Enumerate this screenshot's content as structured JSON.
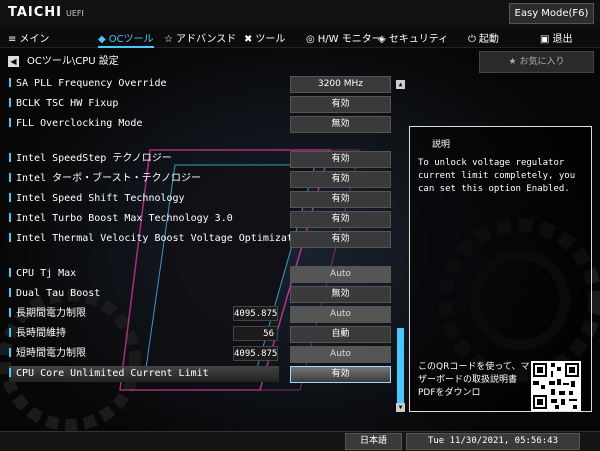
{
  "header": {
    "brand": "TAICHI",
    "brand_sub": "UEFI",
    "easy_mode": "Easy Mode(F6)"
  },
  "menu": {
    "items": [
      {
        "icon": "≡",
        "label": "メイン"
      },
      {
        "icon": "◆",
        "label": "OCツール"
      },
      {
        "icon": "☆",
        "label": "アドバンスド"
      },
      {
        "icon": "✖",
        "label": "ツール"
      },
      {
        "icon": "◎",
        "label": "H/W モニター"
      },
      {
        "icon": "◈",
        "label": "セキュリティ"
      },
      {
        "icon": "⏻",
        "label": "起動"
      },
      {
        "icon": "▣",
        "label": "退出"
      }
    ]
  },
  "breadcrumb": "OCツール\\CPU 設定",
  "favorites": "お気に入り",
  "settings": [
    {
      "label": "SA PLL Frequency Override",
      "value": "3200 MHz",
      "num": ""
    },
    {
      "label": "BCLK TSC HW Fixup",
      "value": "有効",
      "num": ""
    },
    {
      "label": "FLL Overclocking Mode",
      "value": "無効",
      "num": ""
    },
    {
      "label": "Intel SpeedStep テクノロジー",
      "value": "有効",
      "num": ""
    },
    {
      "label": "Intel ターボ・ブースト・テクノロジー",
      "value": "有効",
      "num": ""
    },
    {
      "label": "Intel Speed Shift Technology",
      "value": "有効",
      "num": ""
    },
    {
      "label": "Intel Turbo Boost Max Technology 3.0",
      "value": "有効",
      "num": ""
    },
    {
      "label": "Intel Thermal Velocity Boost Voltage Optimizations",
      "value": "有効",
      "num": ""
    },
    {
      "label": "CPU Tj Max",
      "value": "Auto",
      "num": ""
    },
    {
      "label": "Dual Tau Boost",
      "value": "無効",
      "num": ""
    },
    {
      "label": "長期間電力制限",
      "value": "Auto",
      "num": "4095.875"
    },
    {
      "label": "長時間維持",
      "value": "自動",
      "num": "56"
    },
    {
      "label": "短時間電力制限",
      "value": "Auto",
      "num": "4095.875"
    },
    {
      "label": "CPU Core Unlimited Current Limit",
      "value": "有効",
      "num": ""
    }
  ],
  "description": {
    "title": "説明",
    "text": "To unlock voltage regulator current limit completely, you can set this option Enabled.",
    "qr_text": "このQRコードを使って、マザーボードの取扱説明書PDFをダウンロ"
  },
  "footer": {
    "language": "日本語",
    "datetime": "Tue 11/30/2021, 05:56:43"
  },
  "colors": {
    "accent": "#49c8ff"
  }
}
